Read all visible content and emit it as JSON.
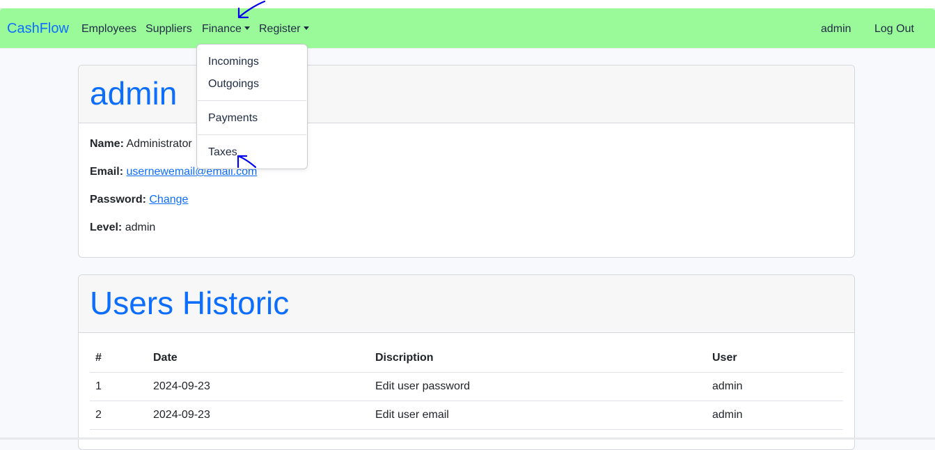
{
  "navbar": {
    "brand": "CashFlow",
    "items": [
      "Employees",
      "Suppliers",
      "Finance",
      "Register"
    ],
    "user": "admin",
    "logout": "Log Out",
    "background": "#9afa9a"
  },
  "finance_menu": {
    "items": [
      "Incomings",
      "Outgoings",
      "Payments",
      "Taxes"
    ]
  },
  "profile": {
    "title": "admin",
    "name_label": "Name:",
    "name_value": "Administrator",
    "email_label": "Email:",
    "email_value": "usernewemail@email.com",
    "password_label": "Password:",
    "password_link": "Change",
    "level_label": "Level:",
    "level_value": "admin"
  },
  "history": {
    "title": "Users Historic",
    "columns": [
      "#",
      "Date",
      "Discription",
      "User"
    ],
    "rows": [
      [
        "1",
        "2024-09-23",
        "Edit user password",
        "admin"
      ],
      [
        "2",
        "2024-09-23",
        "Edit user email",
        "admin"
      ]
    ]
  },
  "colors": {
    "accent": "#0d6efd",
    "annotation": "#0000ee"
  }
}
